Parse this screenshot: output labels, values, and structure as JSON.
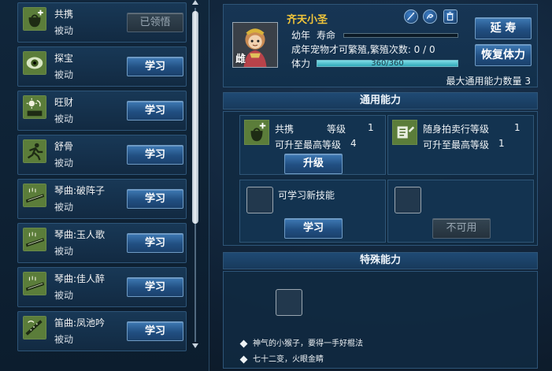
{
  "skills": [
    {
      "name": "共携",
      "type": "被动",
      "button": "已领悟",
      "learned": true,
      "icon": "bag-plus-icon"
    },
    {
      "name": "探宝",
      "type": "被动",
      "button": "学习",
      "learned": false,
      "icon": "eye-icon"
    },
    {
      "name": "旺财",
      "type": "被动",
      "button": "学习",
      "learned": false,
      "icon": "sun-book-icon"
    },
    {
      "name": "舒骨",
      "type": "被动",
      "button": "学习",
      "learned": false,
      "icon": "running-figure-icon"
    },
    {
      "name": "琴曲:破阵子",
      "type": "被动",
      "button": "学习",
      "learned": false,
      "icon": "zither-icon"
    },
    {
      "name": "琴曲:玉人歌",
      "type": "被动",
      "button": "学习",
      "learned": false,
      "icon": "zither-icon"
    },
    {
      "name": "琴曲:佳人醉",
      "type": "被动",
      "button": "学习",
      "learned": false,
      "icon": "zither-icon"
    },
    {
      "name": "笛曲:凤池吟",
      "type": "被动",
      "button": "学习",
      "learned": false,
      "icon": "flute-icon"
    }
  ],
  "pet": {
    "name": "齐天小圣",
    "gender": "雌",
    "stage": "幼年",
    "life_label": "寿命",
    "breed_note": "成年宠物才可繁殖,繁殖次数:  0 / 0",
    "hp_label": "体力",
    "hp_text": "360/360",
    "hp_fraction": 1.0,
    "max_ability": "最大通用能力数量 3",
    "extend_button": "延 寿",
    "restore_button": "恢复体力",
    "header_icons": [
      "feather-icon",
      "swirl-icon",
      "trash-icon"
    ]
  },
  "general": {
    "title": "通用能力",
    "slot1": {
      "name": "共携",
      "level_label": "等级",
      "level": "1",
      "max_label": "可升至最高等级",
      "max": "4",
      "button": "升级"
    },
    "slot2": {
      "name": "随身拍卖行等级",
      "level": "1",
      "max_label": "可升至最高等级",
      "max": "1"
    },
    "slot3": {
      "label": "可学习新技能",
      "button": "学习"
    },
    "slot4": {
      "button": "不可用"
    }
  },
  "special": {
    "title": "特殊能力",
    "notes": [
      "神气的小猴子，要得一手好棍法",
      "七十二变，火眼金睛"
    ]
  },
  "colors": {
    "accent": "#2c5f96",
    "gold_text": "#f2c63a",
    "hp": "#54c3d2"
  }
}
